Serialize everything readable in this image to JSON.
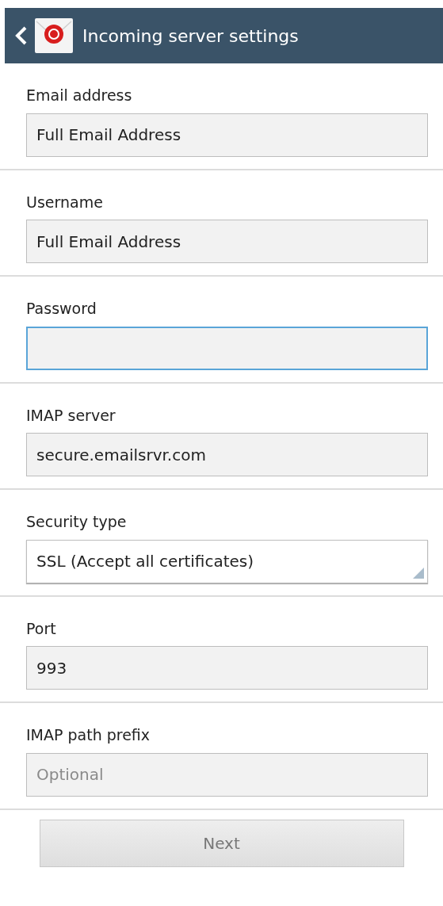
{
  "header": {
    "title": "Incoming server settings"
  },
  "fields": [
    {
      "kind": "text",
      "label": "Email address",
      "value": "Full Email Address",
      "focused": false
    },
    {
      "kind": "text",
      "label": "Username",
      "value": "Full Email Address",
      "focused": false
    },
    {
      "kind": "text",
      "label": "Password",
      "focused": true
    },
    {
      "kind": "text",
      "label": "IMAP server",
      "value": "secure.emailsrvr.com",
      "focused": false
    },
    {
      "kind": "select",
      "label": "Security type",
      "value": "SSL (Accept all certificates)",
      "focused": false
    },
    {
      "kind": "text",
      "label": "Port",
      "value": "993",
      "focused": false
    },
    {
      "kind": "text",
      "label": "IMAP path prefix",
      "placeholder": "Optional",
      "focused": false
    }
  ],
  "next_button": {
    "label": "Next",
    "disabled": true
  }
}
